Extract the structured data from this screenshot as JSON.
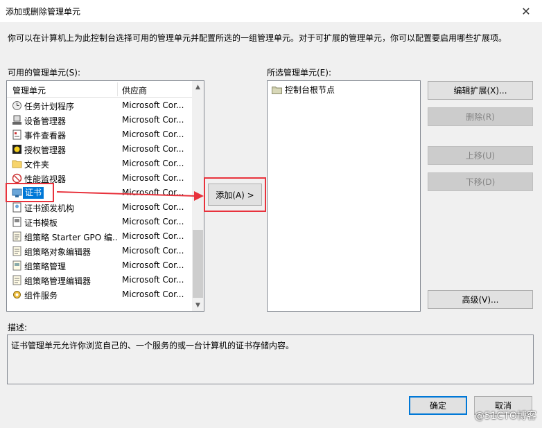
{
  "window": {
    "title": "添加或删除管理单元",
    "close_glyph": "✕"
  },
  "intro_text": "你可以在计算机上为此控制台选择可用的管理单元并配置所选的一组管理单元。对于可扩展的管理单元，你可以配置要启用哪些扩展项。",
  "available": {
    "label": "可用的管理单元(S):",
    "columns": {
      "name": "管理单元",
      "vendor": "供应商"
    },
    "items": [
      {
        "name": "任务计划程序",
        "vendor": "Microsoft Cor...",
        "icon": "clock-icon"
      },
      {
        "name": "设备管理器",
        "vendor": "Microsoft Cor...",
        "icon": "device-manager-icon"
      },
      {
        "name": "事件查看器",
        "vendor": "Microsoft Cor...",
        "icon": "event-viewer-icon"
      },
      {
        "name": "授权管理器",
        "vendor": "Microsoft Cor...",
        "icon": "authorization-icon"
      },
      {
        "name": "文件夹",
        "vendor": "Microsoft Cor...",
        "icon": "folder-icon"
      },
      {
        "name": "性能监视器",
        "vendor": "Microsoft Cor...",
        "icon": "performance-icon"
      },
      {
        "name": "证书",
        "vendor": "Microsoft Cor...",
        "icon": "certificate-icon",
        "selected": true
      },
      {
        "name": "证书颁发机构",
        "vendor": "Microsoft Cor...",
        "icon": "cert-authority-icon"
      },
      {
        "name": "证书模板",
        "vendor": "Microsoft Cor...",
        "icon": "cert-template-icon"
      },
      {
        "name": "组策略 Starter GPO 编...",
        "vendor": "Microsoft Cor...",
        "icon": "gpo-icon"
      },
      {
        "name": "组策略对象编辑器",
        "vendor": "Microsoft Cor...",
        "icon": "gpo-icon"
      },
      {
        "name": "组策略管理",
        "vendor": "Microsoft Cor...",
        "icon": "gpo-management-icon"
      },
      {
        "name": "组策略管理编辑器",
        "vendor": "Microsoft Cor...",
        "icon": "gpo-icon"
      },
      {
        "name": "组件服务",
        "vendor": "Microsoft Cor...",
        "icon": "component-services-icon"
      }
    ]
  },
  "selected_list": {
    "label": "所选管理单元(E):",
    "root_node": "控制台根节点"
  },
  "buttons": {
    "add": "添加(A) >",
    "edit_extensions": "编辑扩展(X)...",
    "remove": "删除(R)",
    "move_up": "上移(U)",
    "move_down": "下移(D)",
    "advanced": "高级(V)...",
    "ok": "确定",
    "cancel": "取消"
  },
  "description": {
    "label": "描述:",
    "text": "证书管理单元允许你浏览自己的、一个服务的或一台计算机的证书存储内容。"
  },
  "watermark": "@51CTO博客",
  "colors": {
    "selection": "#0078d7",
    "annotation": "#e8323c"
  }
}
